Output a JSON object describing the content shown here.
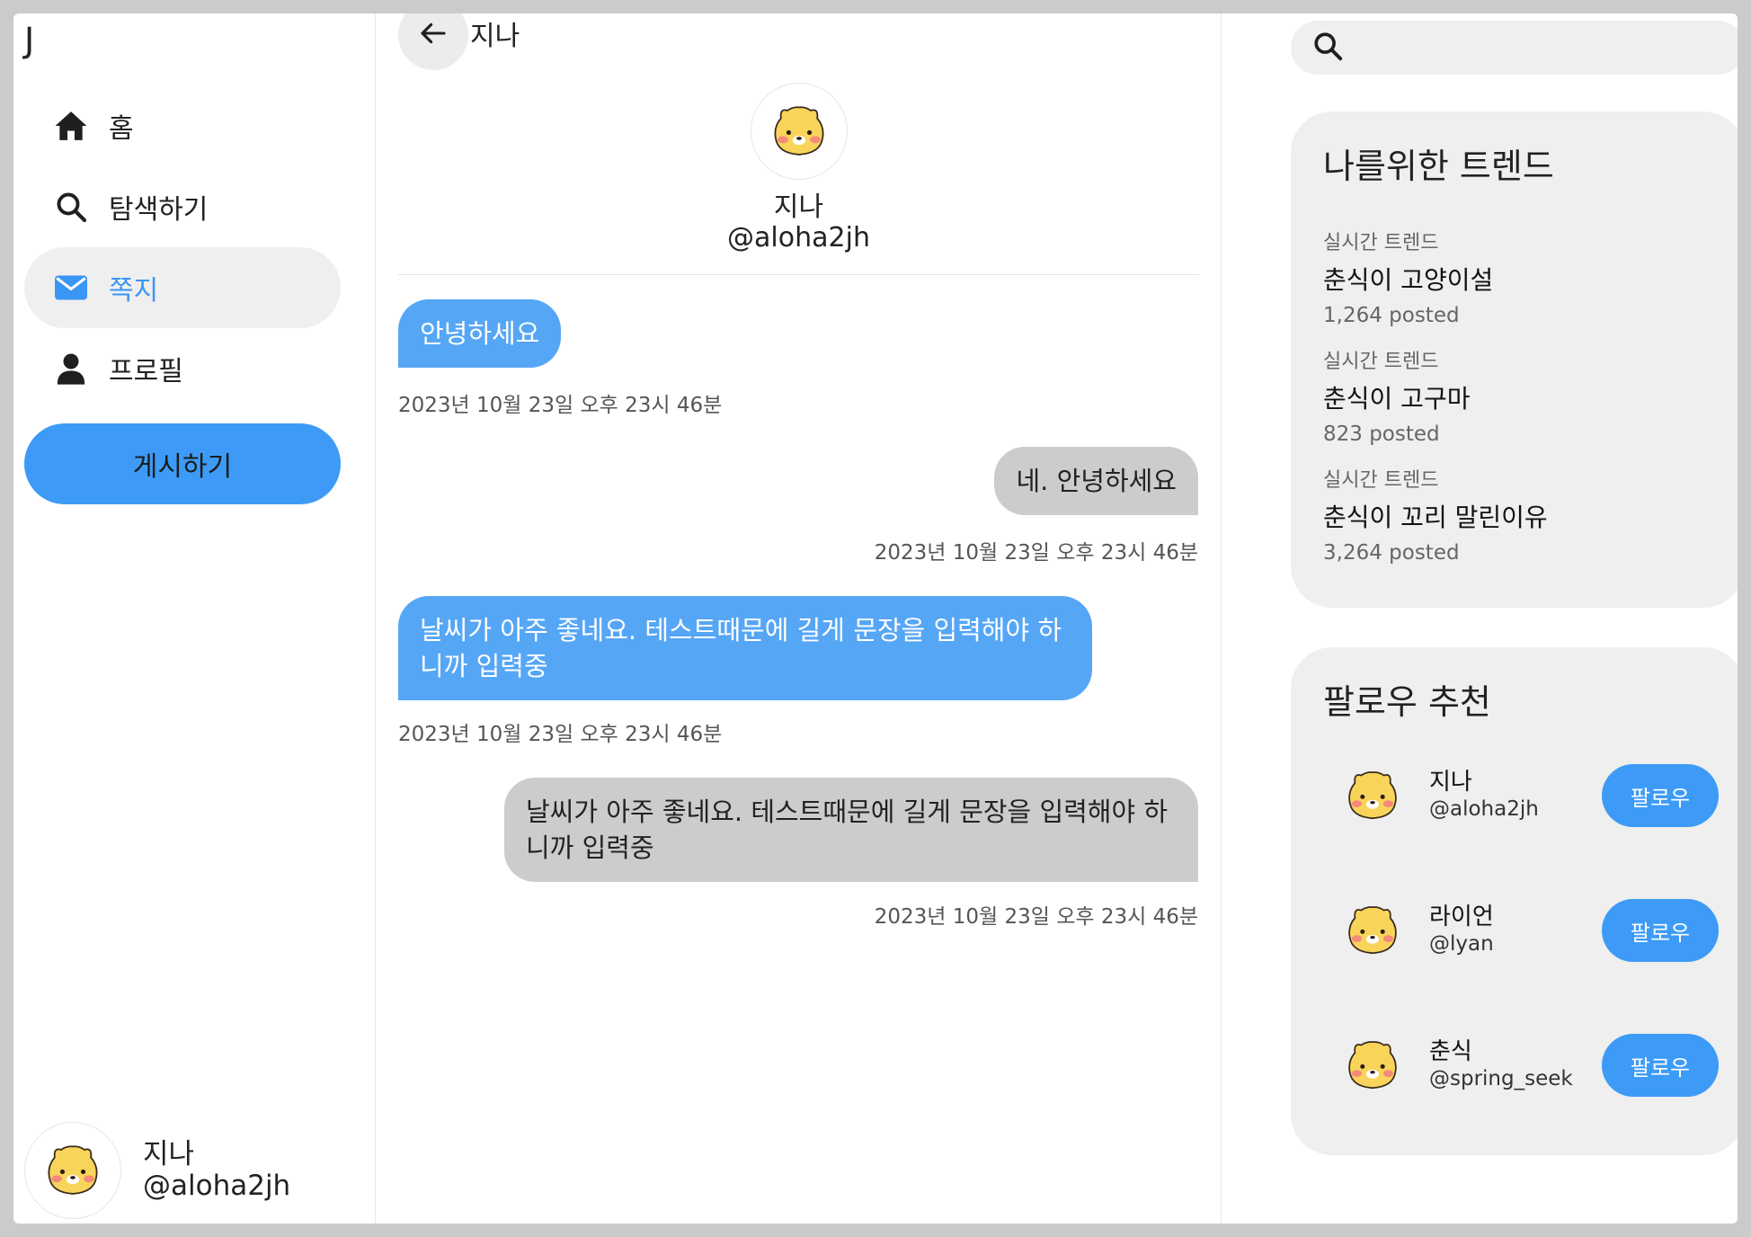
{
  "sidebar": {
    "logo": "J",
    "nav": [
      {
        "label": "홈",
        "icon": "home-icon"
      },
      {
        "label": "탐색하기",
        "icon": "search-icon"
      },
      {
        "label": "쪽지",
        "icon": "mail-icon",
        "active": true
      },
      {
        "label": "프로필",
        "icon": "person-icon"
      }
    ],
    "post_button": "게시하기",
    "me": {
      "name": "지나",
      "handle": "@aloha2jh"
    }
  },
  "chat": {
    "title": "지나",
    "partner": {
      "name": "지나",
      "handle": "@aloha2jh"
    },
    "messages": [
      {
        "text": "안녕하세요",
        "time": "2023년 10월 23일 오후 23시 46분",
        "side": "received"
      },
      {
        "text": "네. 안녕하세요",
        "time": "2023년 10월 23일 오후 23시 46분",
        "side": "sent"
      },
      {
        "text": "날씨가 아주 좋네요. 테스트때문에 길게 문장을 입력해야 하니까 입력중",
        "time": "2023년 10월 23일 오후 23시 46분",
        "side": "received"
      },
      {
        "text": "날씨가 아주 좋네요. 테스트때문에 길게 문장을 입력해야 하니까 입력중",
        "time": "2023년 10월 23일 오후 23시 46분",
        "side": "sent"
      }
    ]
  },
  "search": {
    "placeholder": ""
  },
  "trends": {
    "title": "나를위한 트렌드",
    "items": [
      {
        "label": "실시간 트렌드",
        "name": "춘식이 고양이설",
        "count": "1,264 posted"
      },
      {
        "label": "실시간 트렌드",
        "name": "춘식이 고구마",
        "count": "823 posted"
      },
      {
        "label": "실시간 트렌드",
        "name": "춘식이 꼬리 말린이유",
        "count": "3,264 posted"
      }
    ]
  },
  "follow": {
    "title": "팔로우 추천",
    "button_label": "팔로우",
    "items": [
      {
        "name": "지나",
        "handle": "@aloha2jh"
      },
      {
        "name": "라이언",
        "handle": "@lyan"
      },
      {
        "name": "춘식",
        "handle": "@spring_seek"
      }
    ]
  },
  "colors": {
    "accent": "#3d9bf7",
    "bubble_received": "#56a6f6",
    "bubble_sent": "#cccccc",
    "panel": "#efefef"
  }
}
